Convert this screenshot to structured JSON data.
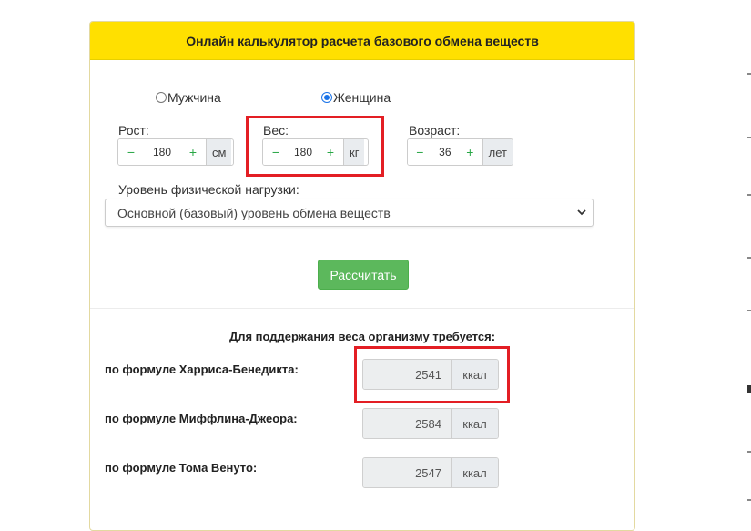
{
  "header": {
    "title": "Онлайн калькулятор расчета базового обмена веществ"
  },
  "gender": {
    "male_label": "Мужчина",
    "female_label": "Женщина",
    "selected": "female"
  },
  "height": {
    "label": "Рост:",
    "minus": "−",
    "plus": "+",
    "value": "180",
    "unit": "см"
  },
  "weight": {
    "label": "Вес:",
    "minus": "−",
    "plus": "+",
    "value": "180",
    "unit": "кг"
  },
  "age": {
    "label": "Возраст:",
    "minus": "−",
    "plus": "+",
    "value": "36",
    "unit": "лет"
  },
  "activity": {
    "label": "Уровень физической нагрузки:",
    "selected": "Основной (базовый) уровень обмена веществ"
  },
  "calculate_button": "Рассчитать",
  "results": {
    "title": "Для поддержания веса организму требуется:",
    "rows": [
      {
        "label": "по формуле Харриса-Бенедикта:",
        "value": "2541",
        "unit": "ккал"
      },
      {
        "label": "по формуле Миффлина-Джеора:",
        "value": "2584",
        "unit": "ккал"
      },
      {
        "label": "по формуле Тома Венуто:",
        "value": "2547",
        "unit": "ккал"
      }
    ]
  },
  "colors": {
    "header_bg": "#ffe000",
    "button_green": "#5cb85c",
    "highlight_red": "#e31e24",
    "stepper_green": "#28a745"
  }
}
